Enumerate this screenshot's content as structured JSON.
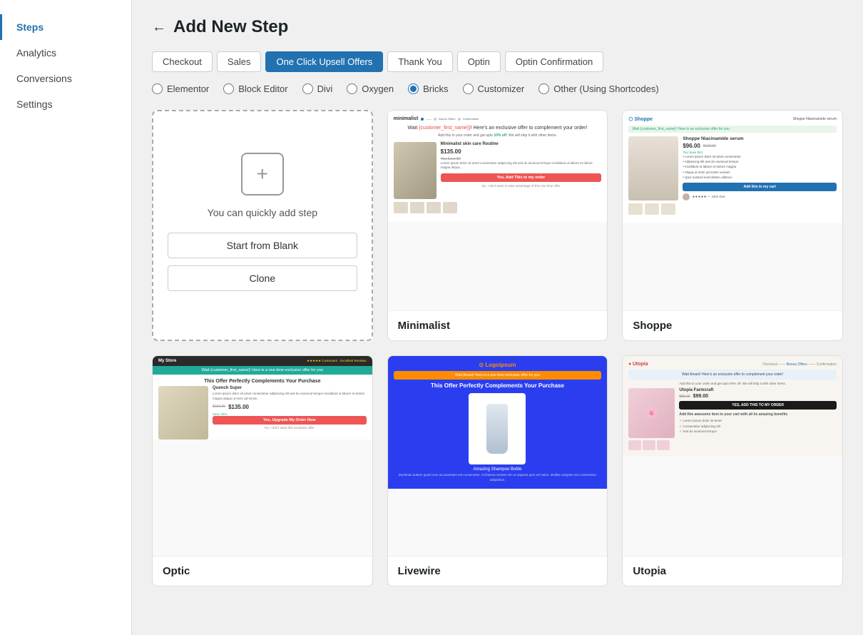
{
  "sidebar": {
    "items": [
      {
        "id": "steps",
        "label": "Steps",
        "active": true
      },
      {
        "id": "analytics",
        "label": "Analytics",
        "active": false
      },
      {
        "id": "conversions",
        "label": "Conversions",
        "active": false
      },
      {
        "id": "settings",
        "label": "Settings",
        "active": false
      }
    ]
  },
  "header": {
    "back_label": "←",
    "title": "Add New Step"
  },
  "step_tabs": [
    {
      "id": "checkout",
      "label": "Checkout",
      "active": false
    },
    {
      "id": "sales",
      "label": "Sales",
      "active": false
    },
    {
      "id": "one-click-upsell",
      "label": "One Click Upsell Offers",
      "active": true
    },
    {
      "id": "thank-you",
      "label": "Thank You",
      "active": false
    },
    {
      "id": "optin",
      "label": "Optin",
      "active": false
    },
    {
      "id": "optin-confirmation",
      "label": "Optin Confirmation",
      "active": false
    }
  ],
  "editor_options": [
    {
      "id": "elementor",
      "label": "Elementor",
      "checked": false
    },
    {
      "id": "block-editor",
      "label": "Block Editor",
      "checked": false
    },
    {
      "id": "divi",
      "label": "Divi",
      "checked": false
    },
    {
      "id": "oxygen",
      "label": "Oxygen",
      "checked": false
    },
    {
      "id": "bricks",
      "label": "Bricks",
      "checked": true
    },
    {
      "id": "customizer",
      "label": "Customizer",
      "checked": false
    },
    {
      "id": "other",
      "label": "Other (Using Shortcodes)",
      "checked": false
    }
  ],
  "blank_card": {
    "add_text": "You can quickly add step",
    "start_label": "Start from Blank",
    "clone_label": "Clone"
  },
  "templates": [
    {
      "id": "minimalist",
      "label": "Minimalist"
    },
    {
      "id": "shoppe",
      "label": "Shoppe"
    },
    {
      "id": "optic",
      "label": "Optic"
    },
    {
      "id": "livewire",
      "label": "Livewire"
    },
    {
      "id": "utopia",
      "label": "Utopia"
    }
  ]
}
